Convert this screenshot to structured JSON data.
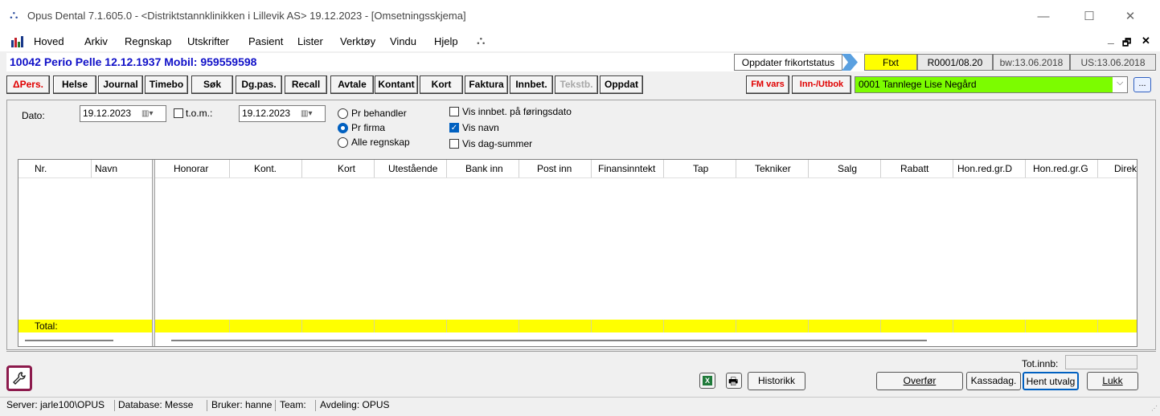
{
  "window": {
    "title": "Opus Dental 7.1.605.0 - <Distriktstannklinikken i Lillevik AS> 19.12.2023 - [Omsetningsskjema]",
    "minimize": "—",
    "maximize": "☐",
    "close": "✕"
  },
  "menu": {
    "items": [
      "Hoved",
      "Arkiv",
      "Regnskap",
      "Utskrifter",
      "Pasient",
      "Lister",
      "Verktøy",
      "Vindu",
      "Hjelp"
    ],
    "right_min": "_",
    "right_restore": "🗗",
    "right_close": "✕"
  },
  "patient": {
    "label": "10042 Perio Pelle 12.12.1937  Mobil: 959559598",
    "update_free_card": "Oppdater frikortstatus",
    "ftxt": "Ftxt",
    "r_code": "R0001/08.20",
    "bw": "bw:13.06.2018",
    "us": "US:13.06.2018"
  },
  "toolbar": {
    "pers_prefix": "Δ",
    "pers": "Pers.",
    "helse": "Helse",
    "journal": "Journal",
    "timebo": "Timebo",
    "sok": "Søk",
    "dgpas": "Dg.pas.",
    "recall": "Recall",
    "avtale": "Avtale",
    "kontant": "Kontant",
    "kort": "Kort",
    "faktura": "Faktura",
    "innbet": "Innbet.",
    "tekstb": "Tekstb.",
    "oppdat": "Oppdat",
    "fmvars": "FM vars",
    "innutbok": "Inn-/Utbok",
    "provider": "0001 Tannlege Lise Negård",
    "more": "..."
  },
  "filters": {
    "dato_label": "Dato:",
    "date_from": "19.12.2023",
    "tom_label": "t.o.m.:",
    "date_to": "19.12.2023",
    "radios": [
      "Pr behandler",
      "Pr firma",
      "Alle regnskap"
    ],
    "selected_radio": "Pr firma",
    "checkboxes": [
      {
        "label": "Vis innbet. på føringsdato",
        "checked": false
      },
      {
        "label": "Vis navn",
        "checked": true
      },
      {
        "label": "Vis dag-summer",
        "checked": false
      }
    ]
  },
  "grid": {
    "left_columns": [
      "Nr.",
      "Navn"
    ],
    "columns": [
      "Honorar",
      "Kont.",
      "Kort",
      "Utestående",
      "Bank inn",
      "Post inn",
      "Finansinntekt",
      "Tap",
      "Tekniker",
      "Salg",
      "Rabatt",
      "Hon.red.gr.D",
      "Hon.red.gr.G",
      "Direk"
    ],
    "total_label": "Total:",
    "row_highlight_color": "#ffff00"
  },
  "bottom": {
    "tot_innb_label": "Tot.innb:",
    "historikk": "Historikk",
    "overfor": "Overfør",
    "kassadag": "Kassadag.",
    "hent_utvalg": "Hent utvalg",
    "lukk": "Lukk",
    "excel_icon": "excel-icon",
    "print_icon": "printer-icon",
    "tools_icon": "wrench-icon"
  },
  "status": {
    "server": "Server: jarle100\\OPUS",
    "database": "Database: Messe",
    "bruker": "Bruker: hanne",
    "team": "Team:",
    "avdeling": "Avdeling: OPUS"
  }
}
